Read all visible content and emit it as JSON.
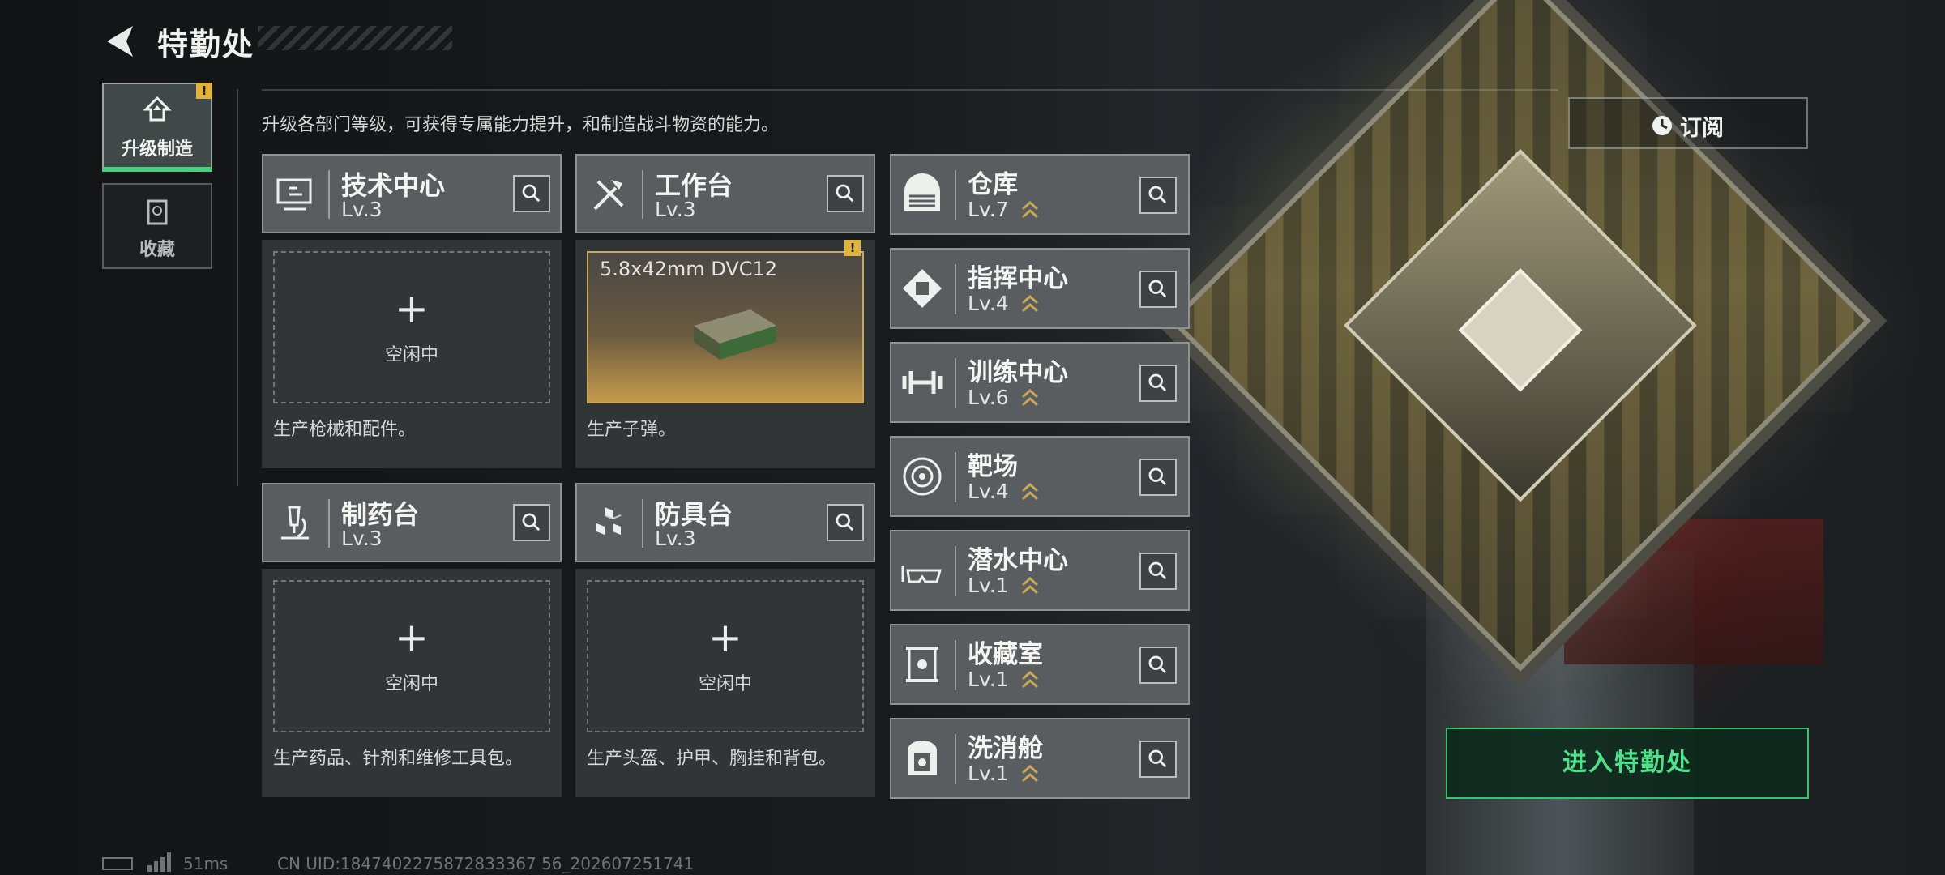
{
  "header": {
    "title": "特勤处"
  },
  "nav": [
    {
      "label": "升级制造",
      "icon": "upgrade-icon",
      "active": true,
      "badge": "!"
    },
    {
      "label": "收藏",
      "icon": "collection-icon",
      "active": false
    }
  ],
  "description": "升级各部门等级，可获得专属能力提升，和制造战斗物资的能力。",
  "workstations": [
    {
      "name": "技术中心",
      "level": "Lv.3",
      "icon": "computer-icon",
      "slot_state": "空闲中",
      "caption": "生产枪械和配件。"
    },
    {
      "name": "工作台",
      "level": "Lv.3",
      "icon": "tools-icon",
      "product": "5.8x42mm DVC12",
      "badge": "!",
      "caption": "生产子弹。"
    },
    {
      "name": "制药台",
      "level": "Lv.3",
      "icon": "microscope-icon",
      "slot_state": "空闲中",
      "caption": "生产药品、针剂和维修工具包。"
    },
    {
      "name": "防具台",
      "level": "Lv.3",
      "icon": "armor-blocks-icon",
      "slot_state": "空闲中",
      "caption": "生产头盔、护甲、胸挂和背包。"
    }
  ],
  "rooms": [
    {
      "name": "仓库",
      "level": "Lv.7",
      "icon": "warehouse-icon"
    },
    {
      "name": "指挥中心",
      "level": "Lv.4",
      "icon": "chip-icon"
    },
    {
      "name": "训练中心",
      "level": "Lv.6",
      "icon": "dumbbell-icon"
    },
    {
      "name": "靶场",
      "level": "Lv.4",
      "icon": "target-icon"
    },
    {
      "name": "潜水中心",
      "level": "Lv.1",
      "icon": "goggles-icon"
    },
    {
      "name": "收藏室",
      "level": "Lv.1",
      "icon": "display-case-icon"
    },
    {
      "name": "洗消舱",
      "level": "Lv.1",
      "icon": "decon-chamber-icon"
    }
  ],
  "subscribe_label": "订阅",
  "enter_label": "进入特勤处",
  "status": {
    "ping": "51ms",
    "uid": "CN UID:1847402275872833367 56_202607251741"
  },
  "colors": {
    "accent_green": "#45d17d",
    "warning": "#e0b43c",
    "card": "#595d5f"
  }
}
